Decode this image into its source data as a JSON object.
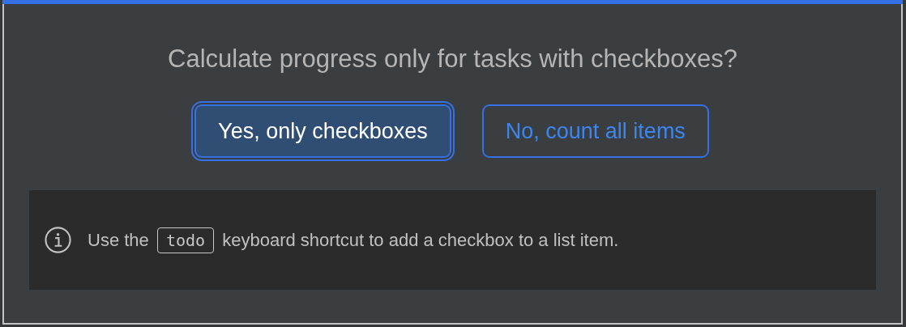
{
  "dialog": {
    "title": "Calculate progress only for tasks with checkboxes?",
    "buttons": [
      {
        "label": "Yes, only checkboxes",
        "selected": true
      },
      {
        "label": "No, count all items",
        "selected": false
      }
    ],
    "notice": {
      "before": "Use the",
      "key": "todo",
      "after": "keyboard shortcut to add a checkbox to a list item."
    }
  }
}
